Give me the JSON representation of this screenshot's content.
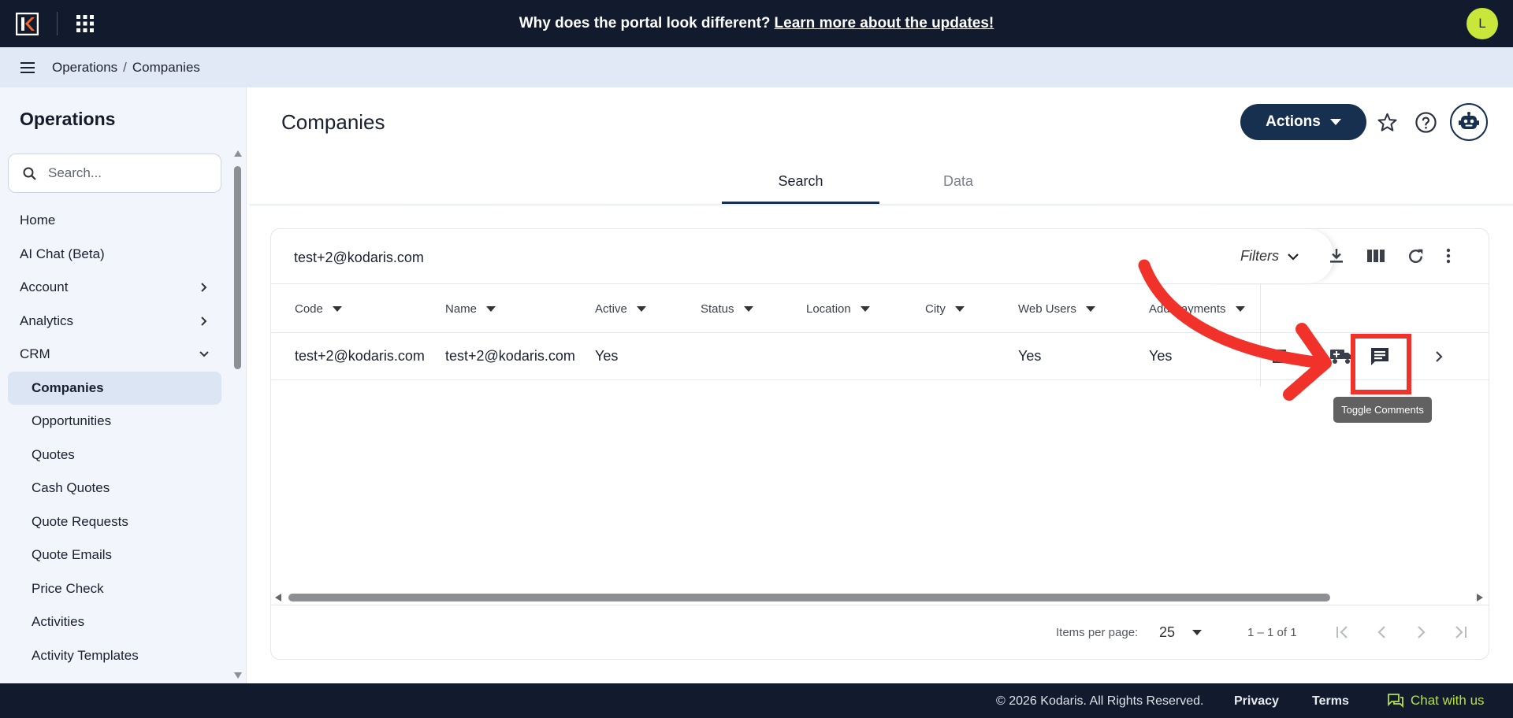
{
  "banner": {
    "question": "Why does the portal look different?",
    "link": "Learn more about the updates!"
  },
  "user": {
    "avatar_initial": "L",
    "avatar_color": "#c9e63a"
  },
  "breadcrumb": {
    "section": "Operations",
    "separator": "/",
    "page": "Companies"
  },
  "sidebar": {
    "title": "Operations",
    "search_placeholder": "Search...",
    "items": [
      {
        "label": "Home",
        "type": "link"
      },
      {
        "label": "AI Chat (Beta)",
        "type": "link"
      },
      {
        "label": "Account",
        "type": "collapsed"
      },
      {
        "label": "Analytics",
        "type": "collapsed"
      },
      {
        "label": "CRM",
        "type": "expanded"
      },
      {
        "label": "Companies",
        "type": "sub",
        "active": true
      },
      {
        "label": "Opportunities",
        "type": "sub"
      },
      {
        "label": "Quotes",
        "type": "sub"
      },
      {
        "label": "Cash Quotes",
        "type": "sub"
      },
      {
        "label": "Quote Requests",
        "type": "sub"
      },
      {
        "label": "Quote Emails",
        "type": "sub"
      },
      {
        "label": "Price Check",
        "type": "sub"
      },
      {
        "label": "Activities",
        "type": "sub"
      },
      {
        "label": "Activity Templates",
        "type": "sub"
      }
    ]
  },
  "main": {
    "title": "Companies",
    "actions_label": "Actions",
    "tabs": [
      {
        "label": "Search",
        "active": true
      },
      {
        "label": "Data",
        "active": false
      }
    ]
  },
  "grid": {
    "search_value": "test+2@kodaris.com",
    "filters_label": "Filters",
    "columns": [
      "Code",
      "Name",
      "Active",
      "Status",
      "Location",
      "City",
      "Web Users",
      "Add Payments"
    ],
    "rows": [
      {
        "code": "test+2@kodaris.com",
        "name": "test+2@kodaris.com",
        "active": "Yes",
        "status": "",
        "location": "",
        "city": "",
        "web_users": "Yes",
        "add_payments": "Yes"
      }
    ],
    "tooltip": "Toggle Comments",
    "pager": {
      "items_per_page_label": "Items per page:",
      "page_size": "25",
      "range": "1 – 1 of 1"
    }
  },
  "footer": {
    "copyright": "© 2026 Kodaris. All Rights Reserved.",
    "privacy": "Privacy",
    "terms": "Terms",
    "chat": "Chat with us"
  },
  "colors": {
    "topbar": "#121a2e",
    "brand_navy": "#17304f",
    "highlight_red": "#f0322a",
    "chat_green": "#b5e04a"
  }
}
